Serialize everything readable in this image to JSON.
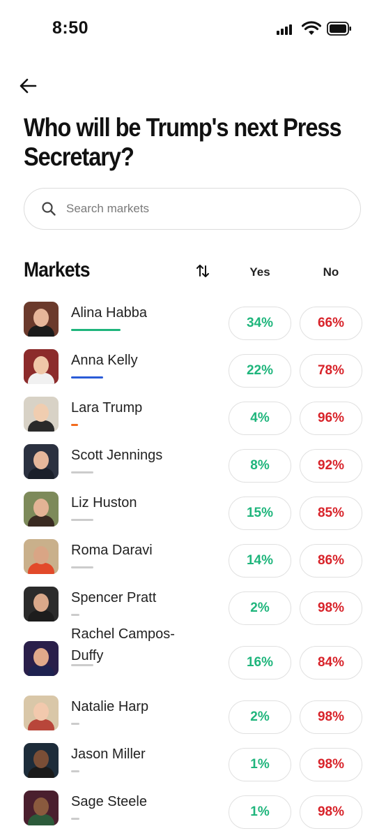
{
  "status": {
    "time": "8:50"
  },
  "title": "Who will be Trump's next Press Secretary?",
  "search": {
    "placeholder": "Search markets",
    "value": ""
  },
  "markets_header": {
    "title": "Markets",
    "yes": "Yes",
    "no": "No"
  },
  "colors": {
    "yes": "#1fb57c",
    "no": "#d8232a"
  },
  "markets": [
    {
      "name": "Alina Habba",
      "yes": "34%",
      "no": "66%",
      "bar_color": "#1fb57c",
      "bar_fraction": 0.34
    },
    {
      "name": "Anna Kelly",
      "yes": "22%",
      "no": "78%",
      "bar_color": "#2a5bd7",
      "bar_fraction": 0.22
    },
    {
      "name": "Lara Trump",
      "yes": "4%",
      "no": "96%",
      "bar_color": "#f26b1d",
      "bar_fraction": 0.04
    },
    {
      "name": "Scott Jennings",
      "yes": "8%",
      "no": "92%",
      "bar_color": "#cccccc",
      "bar_fraction": 0.08
    },
    {
      "name": "Liz Huston",
      "yes": "15%",
      "no": "85%",
      "bar_color": "#cccccc",
      "bar_fraction": 0.15
    },
    {
      "name": "Roma Daravi",
      "yes": "14%",
      "no": "86%",
      "bar_color": "#cccccc",
      "bar_fraction": 0.14
    },
    {
      "name": "Spencer Pratt",
      "yes": "2%",
      "no": "98%",
      "bar_color": "#cccccc",
      "bar_fraction": 0.02
    },
    {
      "name": "Rachel Campos-Duffy",
      "yes": "16%",
      "no": "84%",
      "bar_color": "#cccccc",
      "bar_fraction": 0.16
    },
    {
      "name": "Natalie Harp",
      "yes": "2%",
      "no": "98%",
      "bar_color": "#cccccc",
      "bar_fraction": 0.02
    },
    {
      "name": "Jason Miller",
      "yes": "1%",
      "no": "98%",
      "bar_color": "#cccccc",
      "bar_fraction": 0.01
    },
    {
      "name": "Sage Steele",
      "yes": "1%",
      "no": "98%",
      "bar_color": "#cccccc",
      "bar_fraction": 0.01
    }
  ]
}
